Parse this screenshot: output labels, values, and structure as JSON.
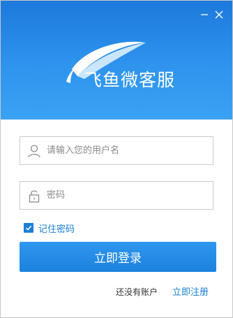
{
  "header": {
    "brand": "飞鱼微客服",
    "minimize_icon": "minimize-icon",
    "close_icon": "close-icon",
    "accent_color": "#2b8fe8"
  },
  "form": {
    "username_placeholder": "请输入您的用户名",
    "username_value": "",
    "username_icon": "user-icon",
    "password_placeholder": "密码",
    "password_value": "",
    "password_icon": "lock-icon",
    "remember_label": "记住密码",
    "remember_checked": true,
    "login_label": "立即登录"
  },
  "footer": {
    "no_account_text": "还没有账户",
    "register_label": "立即注册"
  }
}
